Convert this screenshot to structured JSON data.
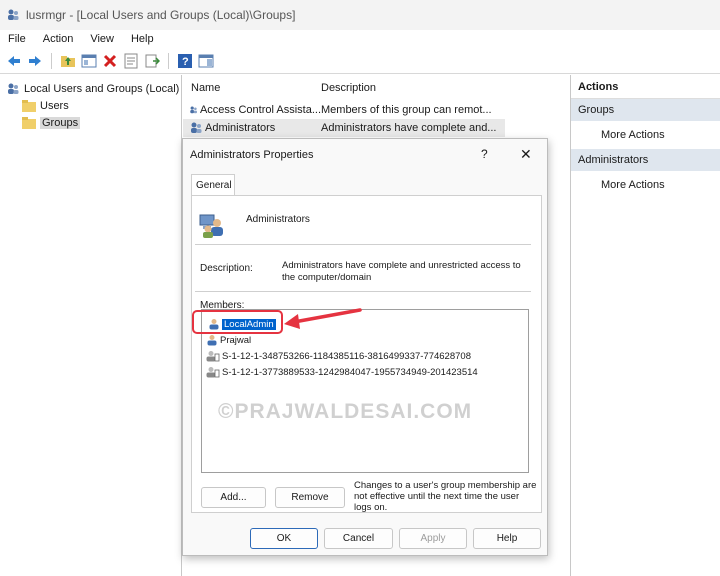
{
  "window": {
    "title": "lusrmgr - [Local Users and Groups (Local)\\Groups]"
  },
  "menu": [
    "File",
    "Action",
    "View",
    "Help"
  ],
  "toolbar": {
    "icons": [
      "back-arrow-icon",
      "forward-arrow-icon",
      "up-folder-icon",
      "show-hide-tree-icon",
      "delete-icon",
      "properties-icon",
      "export-list-icon",
      "help-icon",
      "view-pane-icon"
    ]
  },
  "tree": {
    "root": "Local Users and Groups (Local)",
    "children": [
      "Users",
      "Groups"
    ],
    "selected": "Groups"
  },
  "list": {
    "columns": [
      "Name",
      "Description"
    ],
    "rows": [
      {
        "name": "Access Control Assista...",
        "description": "Members of this group can remot..."
      },
      {
        "name": "Administrators",
        "description": "Administrators have complete and..."
      }
    ],
    "selected_index": 1
  },
  "actions_pane": {
    "title": "Actions",
    "sections": [
      {
        "header": "Groups",
        "item": "More Actions"
      },
      {
        "header": "Administrators",
        "item": "More Actions"
      }
    ]
  },
  "dialog": {
    "title": "Administrators Properties",
    "help": "?",
    "close": "✕",
    "tab": "General",
    "group_name": "Administrators",
    "description_label": "Description:",
    "description": "Administrators have complete and unrestricted access to the computer/domain",
    "members_label": "Members:",
    "members": [
      {
        "name": "LocalAdmin",
        "selected": true
      },
      {
        "name": "Prajwal",
        "selected": false
      },
      {
        "name": "S-1-12-1-348753266-1184385116-3816499337-774628708",
        "selected": false
      },
      {
        "name": "S-1-12-1-3773889533-1242984047-1955734949-201423514",
        "selected": false
      }
    ],
    "watermark": "©PRAJWALDESAI.COM",
    "buttons": {
      "add": "Add...",
      "remove": "Remove",
      "ok": "OK",
      "cancel": "Cancel",
      "apply": "Apply",
      "help": "Help"
    },
    "note": "Changes to a user's group membership are not effective until the next time the user logs on."
  },
  "colors": {
    "highlight_red": "#e53340",
    "selection_blue": "#0063cc",
    "section_bg": "#dfe6ee"
  }
}
